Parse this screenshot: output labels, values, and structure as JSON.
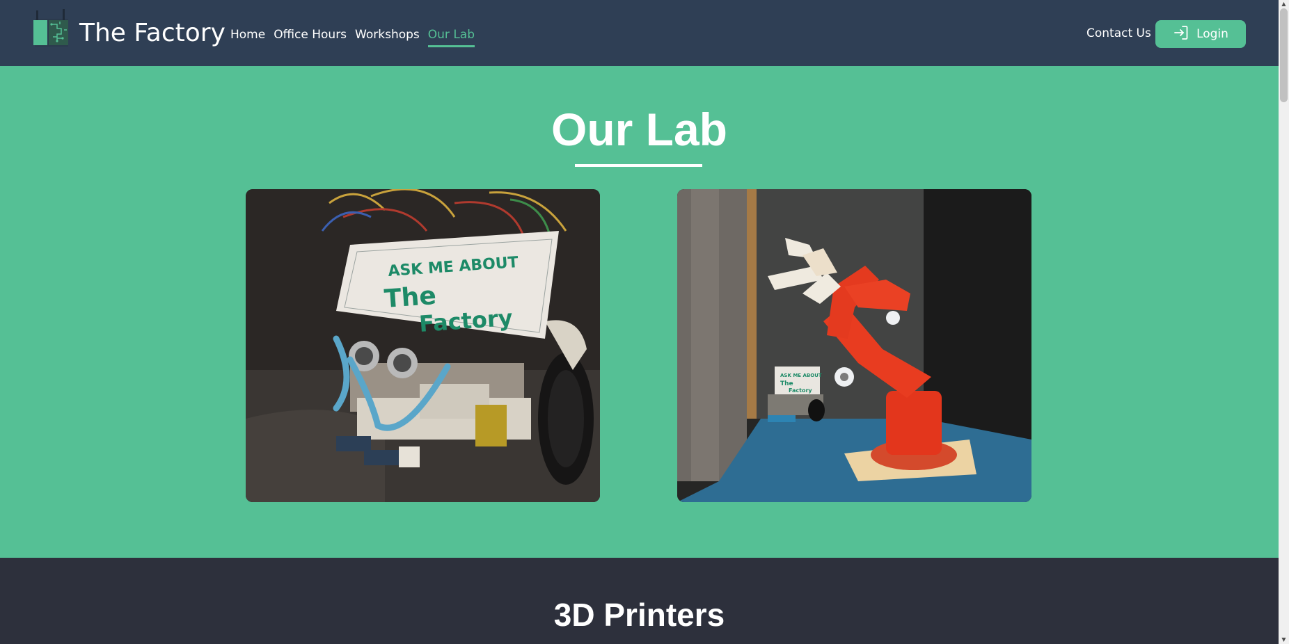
{
  "header": {
    "brand": "The Factory",
    "nav": [
      "Home",
      "Office Hours",
      "Workshops",
      "Our Lab"
    ],
    "active_nav": "Our Lab",
    "contact_label": "Contact Us",
    "login_label": "Login",
    "accent_color": "#55c095",
    "bar_color": "#2f3f55"
  },
  "lab": {
    "title": "Our Lab",
    "photos": [
      {
        "sign_text": [
          "ASK ME ABOUT",
          "The",
          "Factory"
        ]
      },
      {
        "sign_text": [
          "ASK ME ABOUT",
          "The",
          "Factory"
        ]
      }
    ]
  },
  "printers": {
    "title": "3D Printers"
  },
  "icons": {
    "logo": "factory-logo-icon",
    "login": "login-arrow-icon"
  }
}
